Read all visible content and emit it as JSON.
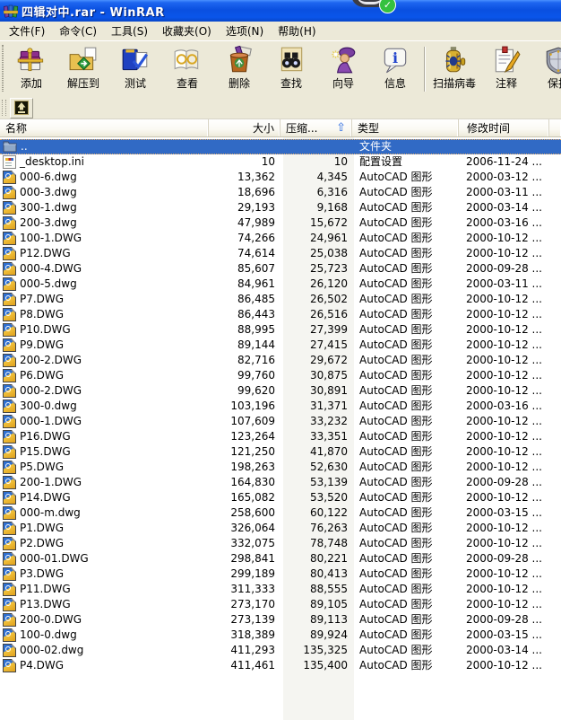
{
  "window": {
    "title": "四辑对中.rar - WinRAR"
  },
  "menu": {
    "items": [
      "文件(F)",
      "命令(C)",
      "工具(S)",
      "收藏夹(O)",
      "选项(N)",
      "帮助(H)"
    ]
  },
  "toolbar": {
    "buttons": [
      {
        "label": "添加",
        "icon": "add-archive-icon"
      },
      {
        "label": "解压到",
        "icon": "extract-to-icon"
      },
      {
        "label": "测试",
        "icon": "test-archive-icon"
      },
      {
        "label": "查看",
        "icon": "view-file-icon"
      },
      {
        "label": "删除",
        "icon": "delete-icon"
      },
      {
        "label": "查找",
        "icon": "find-icon"
      },
      {
        "label": "向导",
        "icon": "wizard-icon"
      },
      {
        "label": "信息",
        "icon": "info-icon"
      },
      {
        "label": "扫描病毒",
        "icon": "scan-virus-icon"
      },
      {
        "label": "注释",
        "icon": "comment-icon"
      },
      {
        "label": "保护",
        "icon": "protect-icon"
      }
    ]
  },
  "columns": [
    {
      "label": "名称"
    },
    {
      "label": "大小"
    },
    {
      "label": "压缩..."
    },
    {
      "label": "类型"
    },
    {
      "label": "修改时间"
    }
  ],
  "sort": {
    "column": "压缩...",
    "direction": "ascending"
  },
  "parent_row": {
    "name": "..",
    "type": "文件夹"
  },
  "files": [
    {
      "name": "_desktop.ini",
      "size": "10",
      "packed": "10",
      "type": "配置设置",
      "date": "2006-11-24 ...",
      "icon": "ini-file-icon"
    },
    {
      "name": "000-6.dwg",
      "size": "13,362",
      "packed": "4,345",
      "type": "AutoCAD 图形",
      "date": "2000-03-12 ...",
      "icon": "dwg-file-icon"
    },
    {
      "name": "000-3.dwg",
      "size": "18,696",
      "packed": "6,316",
      "type": "AutoCAD 图形",
      "date": "2000-03-11 ...",
      "icon": "dwg-file-icon"
    },
    {
      "name": "300-1.dwg",
      "size": "29,193",
      "packed": "9,168",
      "type": "AutoCAD 图形",
      "date": "2000-03-14 ...",
      "icon": "dwg-file-icon"
    },
    {
      "name": "200-3.dwg",
      "size": "47,989",
      "packed": "15,672",
      "type": "AutoCAD 图形",
      "date": "2000-03-16 ...",
      "icon": "dwg-file-icon"
    },
    {
      "name": "100-1.DWG",
      "size": "74,266",
      "packed": "24,961",
      "type": "AutoCAD 图形",
      "date": "2000-10-12 ...",
      "icon": "dwg-file-icon"
    },
    {
      "name": "P12.DWG",
      "size": "74,614",
      "packed": "25,038",
      "type": "AutoCAD 图形",
      "date": "2000-10-12 ...",
      "icon": "dwg-file-icon"
    },
    {
      "name": "000-4.DWG",
      "size": "85,607",
      "packed": "25,723",
      "type": "AutoCAD 图形",
      "date": "2000-09-28 ...",
      "icon": "dwg-file-icon"
    },
    {
      "name": "000-5.dwg",
      "size": "84,961",
      "packed": "26,120",
      "type": "AutoCAD 图形",
      "date": "2000-03-11 ...",
      "icon": "dwg-file-icon"
    },
    {
      "name": "P7.DWG",
      "size": "86,485",
      "packed": "26,502",
      "type": "AutoCAD 图形",
      "date": "2000-10-12 ...",
      "icon": "dwg-file-icon"
    },
    {
      "name": "P8.DWG",
      "size": "86,443",
      "packed": "26,516",
      "type": "AutoCAD 图形",
      "date": "2000-10-12 ...",
      "icon": "dwg-file-icon"
    },
    {
      "name": "P10.DWG",
      "size": "88,995",
      "packed": "27,399",
      "type": "AutoCAD 图形",
      "date": "2000-10-12 ...",
      "icon": "dwg-file-icon"
    },
    {
      "name": "P9.DWG",
      "size": "89,144",
      "packed": "27,415",
      "type": "AutoCAD 图形",
      "date": "2000-10-12 ...",
      "icon": "dwg-file-icon"
    },
    {
      "name": "200-2.DWG",
      "size": "82,716",
      "packed": "29,672",
      "type": "AutoCAD 图形",
      "date": "2000-10-12 ...",
      "icon": "dwg-file-icon"
    },
    {
      "name": "P6.DWG",
      "size": "99,760",
      "packed": "30,875",
      "type": "AutoCAD 图形",
      "date": "2000-10-12 ...",
      "icon": "dwg-file-icon"
    },
    {
      "name": "000-2.DWG",
      "size": "99,620",
      "packed": "30,891",
      "type": "AutoCAD 图形",
      "date": "2000-10-12 ...",
      "icon": "dwg-file-icon"
    },
    {
      "name": "300-0.dwg",
      "size": "103,196",
      "packed": "31,371",
      "type": "AutoCAD 图形",
      "date": "2000-03-16 ...",
      "icon": "dwg-file-icon"
    },
    {
      "name": "000-1.DWG",
      "size": "107,609",
      "packed": "33,232",
      "type": "AutoCAD 图形",
      "date": "2000-10-12 ...",
      "icon": "dwg-file-icon"
    },
    {
      "name": "P16.DWG",
      "size": "123,264",
      "packed": "33,351",
      "type": "AutoCAD 图形",
      "date": "2000-10-12 ...",
      "icon": "dwg-file-icon"
    },
    {
      "name": "P15.DWG",
      "size": "121,250",
      "packed": "41,870",
      "type": "AutoCAD 图形",
      "date": "2000-10-12 ...",
      "icon": "dwg-file-icon"
    },
    {
      "name": "P5.DWG",
      "size": "198,263",
      "packed": "52,630",
      "type": "AutoCAD 图形",
      "date": "2000-10-12 ...",
      "icon": "dwg-file-icon"
    },
    {
      "name": "200-1.DWG",
      "size": "164,830",
      "packed": "53,139",
      "type": "AutoCAD 图形",
      "date": "2000-09-28 ...",
      "icon": "dwg-file-icon"
    },
    {
      "name": "P14.DWG",
      "size": "165,082",
      "packed": "53,520",
      "type": "AutoCAD 图形",
      "date": "2000-10-12 ...",
      "icon": "dwg-file-icon"
    },
    {
      "name": "000-m.dwg",
      "size": "258,600",
      "packed": "60,122",
      "type": "AutoCAD 图形",
      "date": "2000-03-15 ...",
      "icon": "dwg-file-icon"
    },
    {
      "name": "P1.DWG",
      "size": "326,064",
      "packed": "76,263",
      "type": "AutoCAD 图形",
      "date": "2000-10-12 ...",
      "icon": "dwg-file-icon"
    },
    {
      "name": "P2.DWG",
      "size": "332,075",
      "packed": "78,748",
      "type": "AutoCAD 图形",
      "date": "2000-10-12 ...",
      "icon": "dwg-file-icon"
    },
    {
      "name": "000-01.DWG",
      "size": "298,841",
      "packed": "80,221",
      "type": "AutoCAD 图形",
      "date": "2000-09-28 ...",
      "icon": "dwg-file-icon"
    },
    {
      "name": "P3.DWG",
      "size": "299,189",
      "packed": "80,413",
      "type": "AutoCAD 图形",
      "date": "2000-10-12 ...",
      "icon": "dwg-file-icon"
    },
    {
      "name": "P11.DWG",
      "size": "311,333",
      "packed": "88,555",
      "type": "AutoCAD 图形",
      "date": "2000-10-12 ...",
      "icon": "dwg-file-icon"
    },
    {
      "name": "P13.DWG",
      "size": "273,170",
      "packed": "89,105",
      "type": "AutoCAD 图形",
      "date": "2000-10-12 ...",
      "icon": "dwg-file-icon"
    },
    {
      "name": "200-0.DWG",
      "size": "273,139",
      "packed": "89,113",
      "type": "AutoCAD 图形",
      "date": "2000-09-28 ...",
      "icon": "dwg-file-icon"
    },
    {
      "name": "100-0.dwg",
      "size": "318,389",
      "packed": "89,924",
      "type": "AutoCAD 图形",
      "date": "2000-03-15 ...",
      "icon": "dwg-file-icon"
    },
    {
      "name": "000-02.dwg",
      "size": "411,293",
      "packed": "135,325",
      "type": "AutoCAD 图形",
      "date": "2000-03-14 ...",
      "icon": "dwg-file-icon"
    },
    {
      "name": "P4.DWG",
      "size": "411,461",
      "packed": "135,400",
      "type": "AutoCAD 图形",
      "date": "2000-10-12 ...",
      "icon": "dwg-file-icon"
    }
  ],
  "icons": {
    "sort_ascending": "⇧",
    "check": "✓",
    "info_glyph": "i"
  },
  "colors": {
    "titlebar_blue": "#0a50e0",
    "chrome": "#ece9d8",
    "selection_blue": "#316ac5",
    "sorted_column_shade": "#f5f5f1",
    "header_border": "#c9c5b2",
    "ribbon_gold": "#e8b832",
    "badge_green": "#35c13f"
  }
}
